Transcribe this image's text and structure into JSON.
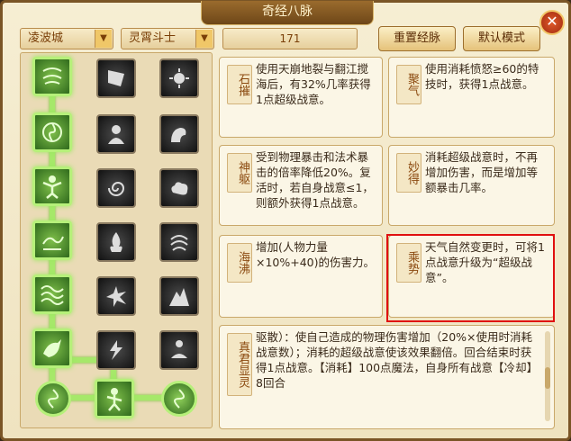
{
  "window": {
    "title": "奇经八脉",
    "close_label": "✕"
  },
  "filters": {
    "sect": "凌波城",
    "school": "灵霄斗士",
    "points": "171"
  },
  "buttons": {
    "reset": "重置经脉",
    "default": "默认模式"
  },
  "skills": [
    {
      "label": "石摧",
      "desc": "使用天崩地裂与翻江搅海后，有32%几率获得1点超级战意。"
    },
    {
      "label": "聚气",
      "desc": "使用消耗愤怒≥60的特技时，获得1点战意。"
    },
    {
      "label": "神躯",
      "desc": "受到物理暴击和法术暴击的倍率降低20%。复活时，若自身战意≤1，则额外获得1点战意。"
    },
    {
      "label": "妙得",
      "desc": "消耗超级战意时，不再增加伤害，而是增加等额暴击几率。"
    },
    {
      "label": "海沸",
      "desc": "增加(人物力量×10%+40)的伤害力。"
    },
    {
      "label": "乘势",
      "desc": "天气自然变更时，可将1点战意升级为“超级战意”。"
    },
    {
      "label": "真君显灵",
      "desc": "驱散）：使自己造成的物理伤害增加（20%×使用时消耗战意数）；消耗的超级战意使该效果翻倍。回合结束时获得1点战意。【消耗】100点魔法，自身所有战意【冷却】8回合"
    }
  ],
  "colors": {
    "accent": "#7a3f08",
    "highlight": "#e01010",
    "active_node": "#9be860"
  }
}
